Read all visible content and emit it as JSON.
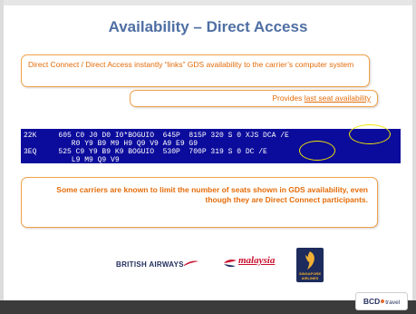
{
  "title": "Availability – Direct Access",
  "callout_top": "Direct Connect / Direct Access instantly “links” GDS availability to the carrier’s computer system",
  "callout_provides": {
    "prefix": "Provides ",
    "link": "last seat availability"
  },
  "terminal_lines": [
    "22K     605 C0 J0 D0 I0*BOGUIO  645P  815P 320 S 0 XJS DCA /E",
    "           R0 Y9 B9 M9 H9 Q9 V9 A9 E9 G9",
    "3EQ     525 C9 Y9 B9 K9 BOGUIO  530P  700P 319 S 0 DC /E",
    "           L9 M9 Q9 V9"
  ],
  "callout_note": "Some carriers are known to limit the number of seats shown in GDS availability, even though they are Direct Connect participants.",
  "logos": {
    "british_airways": "BRITISH AIRWAYS",
    "malaysia": "malaysia",
    "singapore_1": "SINGAPORE",
    "singapore_2": "AIRLINES"
  },
  "footer": {
    "bcd": "BCD",
    "travel": "travel"
  },
  "colors": {
    "title": "#4f6fa3",
    "callout_text": "#e46c0a",
    "callout_border": "#f2a14a",
    "terminal_bg": "#0b0b9c",
    "highlight": "#f2e600"
  }
}
